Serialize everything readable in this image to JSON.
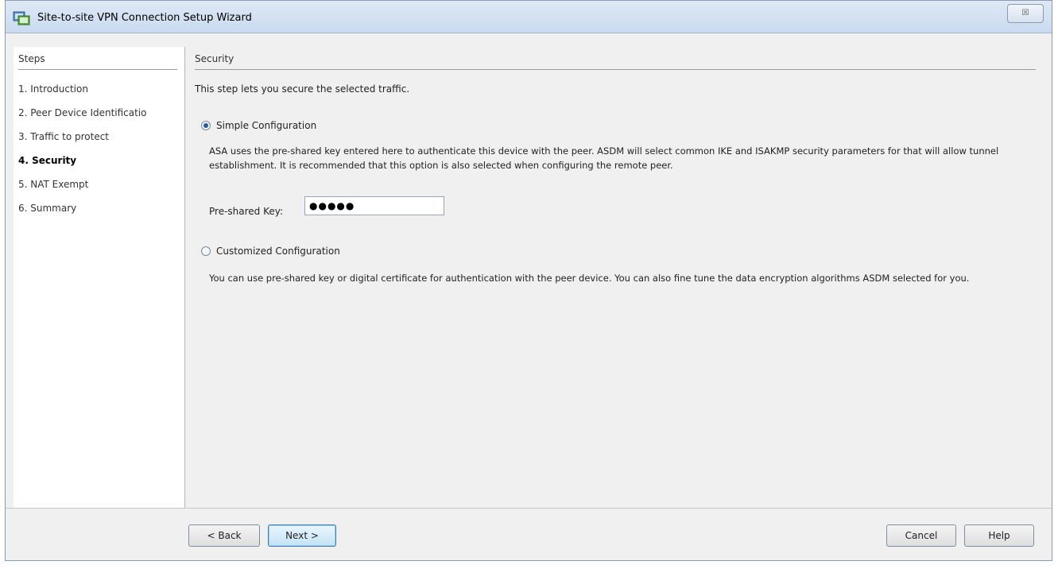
{
  "window": {
    "title": "Site-to-site VPN Connection Setup Wizard",
    "close_glyph": "☒"
  },
  "steps": {
    "header": "Steps",
    "items": [
      {
        "label": "1. Introduction",
        "active": false
      },
      {
        "label": "2. Peer Device Identificatio",
        "active": false
      },
      {
        "label": "3. Traffic to protect",
        "active": false
      },
      {
        "label": "4. Security",
        "active": true
      },
      {
        "label": "5. NAT Exempt",
        "active": false
      },
      {
        "label": "6. Summary",
        "active": false
      }
    ]
  },
  "main": {
    "section_title": "Security",
    "intro": "This step lets you secure the selected traffic.",
    "simple": {
      "label": "Simple Configuration",
      "selected": true,
      "description": "ASA uses the pre-shared key entered here to authenticate this device with the peer. ASDM will select common IKE and ISAKMP security parameters for that will allow tunnel establishment. It is recommended that this option is also selected when configuring the remote peer.",
      "psk_label": "Pre-shared Key:",
      "psk_value": "●●●●●"
    },
    "customized": {
      "label": "Customized Configuration",
      "selected": false,
      "description": "You can use pre-shared key or digital certificate for authentication with the peer device. You can also fine tune the data encryption algorithms ASDM selected for you."
    }
  },
  "footer": {
    "back_label": "< Back",
    "next_label": "Next >",
    "cancel_label": "Cancel",
    "help_label": "Help"
  }
}
